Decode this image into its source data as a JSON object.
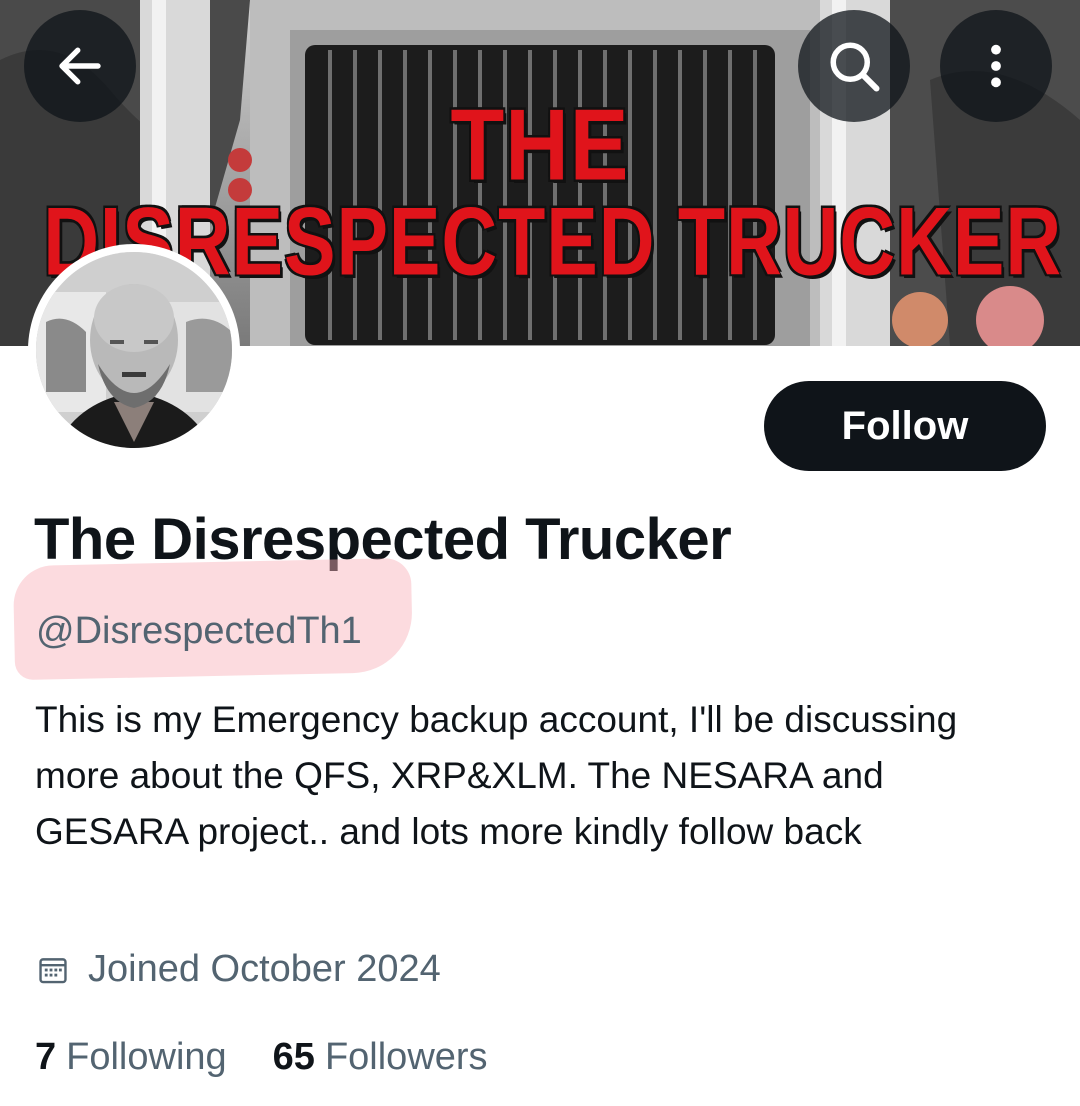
{
  "header": {
    "banner_line1": "THE",
    "banner_line2": "DISRESPECTED TRUCKER",
    "back_icon": "arrow-left-icon",
    "search_icon": "search-icon",
    "more_icon": "more-vertical-icon"
  },
  "profile": {
    "display_name": "The Disrespected Trucker",
    "handle": "@DisrespectedTh1",
    "bio": "This is my Emergency backup account, I'll be discussing more about the QFS, XRP&XLM. The NESARA and GESARA project.. and lots more kindly follow back",
    "joined": "Joined October 2024",
    "joined_icon": "calendar-icon",
    "follow_label": "Follow"
  },
  "stats": {
    "following_count": "7",
    "following_label": "Following",
    "followers_count": "65",
    "followers_label": "Followers"
  },
  "colors": {
    "primary_text": "#0f1419",
    "secondary_text": "#536471",
    "follow_bg": "#0f1419",
    "banner_text": "#e0141b",
    "handle_highlight": "#f8b0b8"
  }
}
